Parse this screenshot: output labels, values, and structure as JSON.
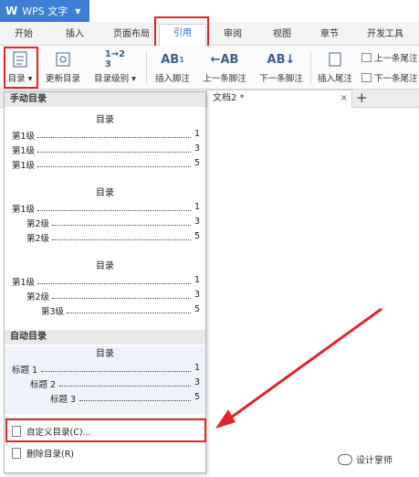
{
  "app": {
    "title": "WPS 文字",
    "logo": "W"
  },
  "tabs": [
    {
      "label": "开始"
    },
    {
      "label": "插入"
    },
    {
      "label": "页面布局"
    },
    {
      "label": "引用"
    },
    {
      "label": "审阅"
    },
    {
      "label": "视图"
    },
    {
      "label": "章节"
    },
    {
      "label": "开发工具"
    }
  ],
  "ribbon": {
    "toc": "目录",
    "update_toc": "更新目录",
    "toc_level": "目录级别",
    "insert_footnote": "插入脚注",
    "prev_footnote": "上一条脚注",
    "next_footnote": "下一条脚注",
    "insert_endnote": "插入尾注",
    "prev_comment": "上一条尾注",
    "next_comment": "下一条尾注",
    "ab": "AB",
    "sup1": "1"
  },
  "doc_tab": {
    "label": "文档2 *",
    "close": "×",
    "plus": "+"
  },
  "dropdown": {
    "manual_header": "手动目录",
    "preview_title": "目录",
    "preview1": [
      {
        "label": "第1级",
        "num": "1"
      },
      {
        "label": "第1级",
        "num": "3"
      },
      {
        "label": "第1级",
        "num": "5"
      }
    ],
    "preview2": [
      {
        "label": "第1级",
        "num": "1"
      },
      {
        "label": "第2级",
        "num": "3"
      },
      {
        "label": "第2级",
        "num": "5"
      }
    ],
    "preview3": [
      {
        "label": "第1级",
        "num": "1"
      },
      {
        "label": "第2级",
        "num": "3"
      },
      {
        "label": "第3级",
        "num": "5"
      }
    ],
    "auto_header": "自动目录",
    "auto_preview": [
      {
        "label": "标题 1",
        "num": "1"
      },
      {
        "label": "标题 2",
        "num": "3"
      },
      {
        "label": "标题 3",
        "num": "5"
      }
    ],
    "custom_toc": "自定义目录(C)...",
    "delete_toc": "删除目录(R)"
  },
  "watermark": "设计掌师",
  "colors": {
    "accent": "#3c7fd4",
    "highlight": "#e0252a",
    "auto_bg": "#eef3fb"
  }
}
